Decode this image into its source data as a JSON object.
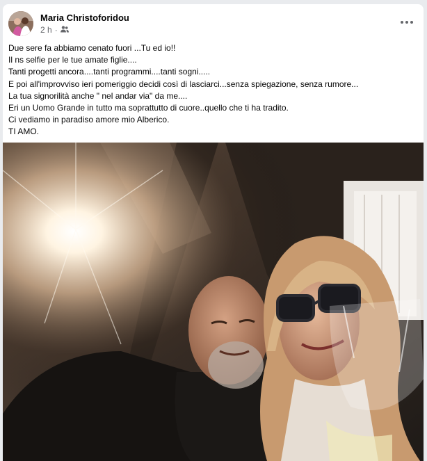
{
  "post": {
    "author": "Maria Christoforidou",
    "timestamp": "2 h",
    "separator": "·",
    "audience_icon": "friends-icon",
    "more_icon": "more-options-icon",
    "lines": [
      "Due sere fa abbiamo cenato fuori ...Tu ed io!!",
      "Il ns selfie per le tue amate figlie....",
      "Tanti progetti ancora....tanti programmi....tanti sogni.....",
      "E poi all'improvviso ieri pomeriggio decidi così di lasciarci...senza spiegazione, senza rumore...",
      "La tua signorilità anche \" nel andar via\" da me....",
      "Eri un Uomo Grande in tutto ma soprattutto di cuore..quello che ti ha tradito.",
      "Ci vediamo in paradiso amore mio Alberico.",
      "TI AMO."
    ]
  }
}
